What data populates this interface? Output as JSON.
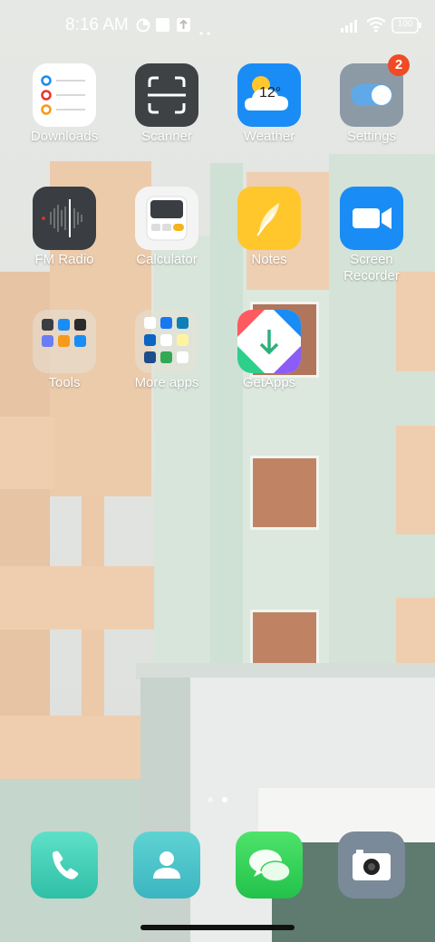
{
  "status": {
    "time": "8:16 AM",
    "battery": "100",
    "icons": [
      "data-saver-icon",
      "square-icon",
      "notification-icon",
      "more-dots-icon",
      "signal-icon",
      "wifi-icon",
      "battery-icon"
    ]
  },
  "apps": {
    "downloads": {
      "label": "Downloads"
    },
    "scanner": {
      "label": "Scanner"
    },
    "weather": {
      "label": "Weather",
      "temp": "12°"
    },
    "settings": {
      "label": "Settings",
      "badge": "2"
    },
    "fm_radio": {
      "label": "FM Radio"
    },
    "calculator": {
      "label": "Calculator"
    },
    "notes": {
      "label": "Notes"
    },
    "screen_recorder": {
      "label": "Screen\nRecorder",
      "line1": "Screen",
      "line2": "Recorder"
    },
    "tools": {
      "label": "Tools"
    },
    "more_apps": {
      "label": "More apps"
    },
    "getapps": {
      "label": "GetApps"
    }
  },
  "dock": [
    "phone-icon",
    "contacts-icon",
    "messages-icon",
    "camera-icon"
  ],
  "page_indicator": {
    "pages": 2,
    "current": 2
  },
  "colors": {
    "accent_blue": "#1a8cf5",
    "badge": "#f04b25",
    "notes_yellow": "#ffc72c",
    "messages_green": "#34d05a"
  }
}
